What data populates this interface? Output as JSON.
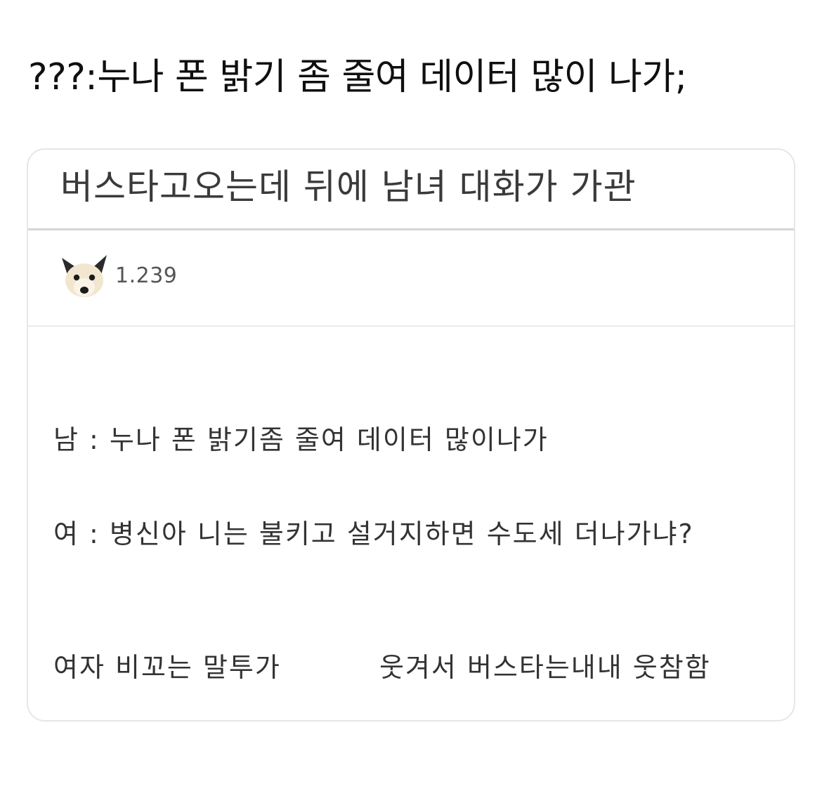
{
  "tweet": {
    "text": "???:누나 폰 밝기 좀 줄여 데이터 많이 나가;"
  },
  "card": {
    "title": "버스타고오는데 뒤에 남녀 대화가 가관",
    "avatar_icon": "dog-avatar-icon",
    "view_count": "1.239",
    "lines": [
      "남 : 누나 폰 밝기좀 줄여 데이터 많이나가",
      "여 : 병신아 니는 불키고 설거지하면 수도세 더나가냐?",
      "여자 비꼬는 말투가",
      "웃겨서 버스타는내내 웃참함"
    ]
  },
  "colors": {
    "card_border": "#e6e6e6",
    "divider": "#d6d6d6",
    "title_text": "#3a3a3a",
    "body_text": "#333333"
  }
}
